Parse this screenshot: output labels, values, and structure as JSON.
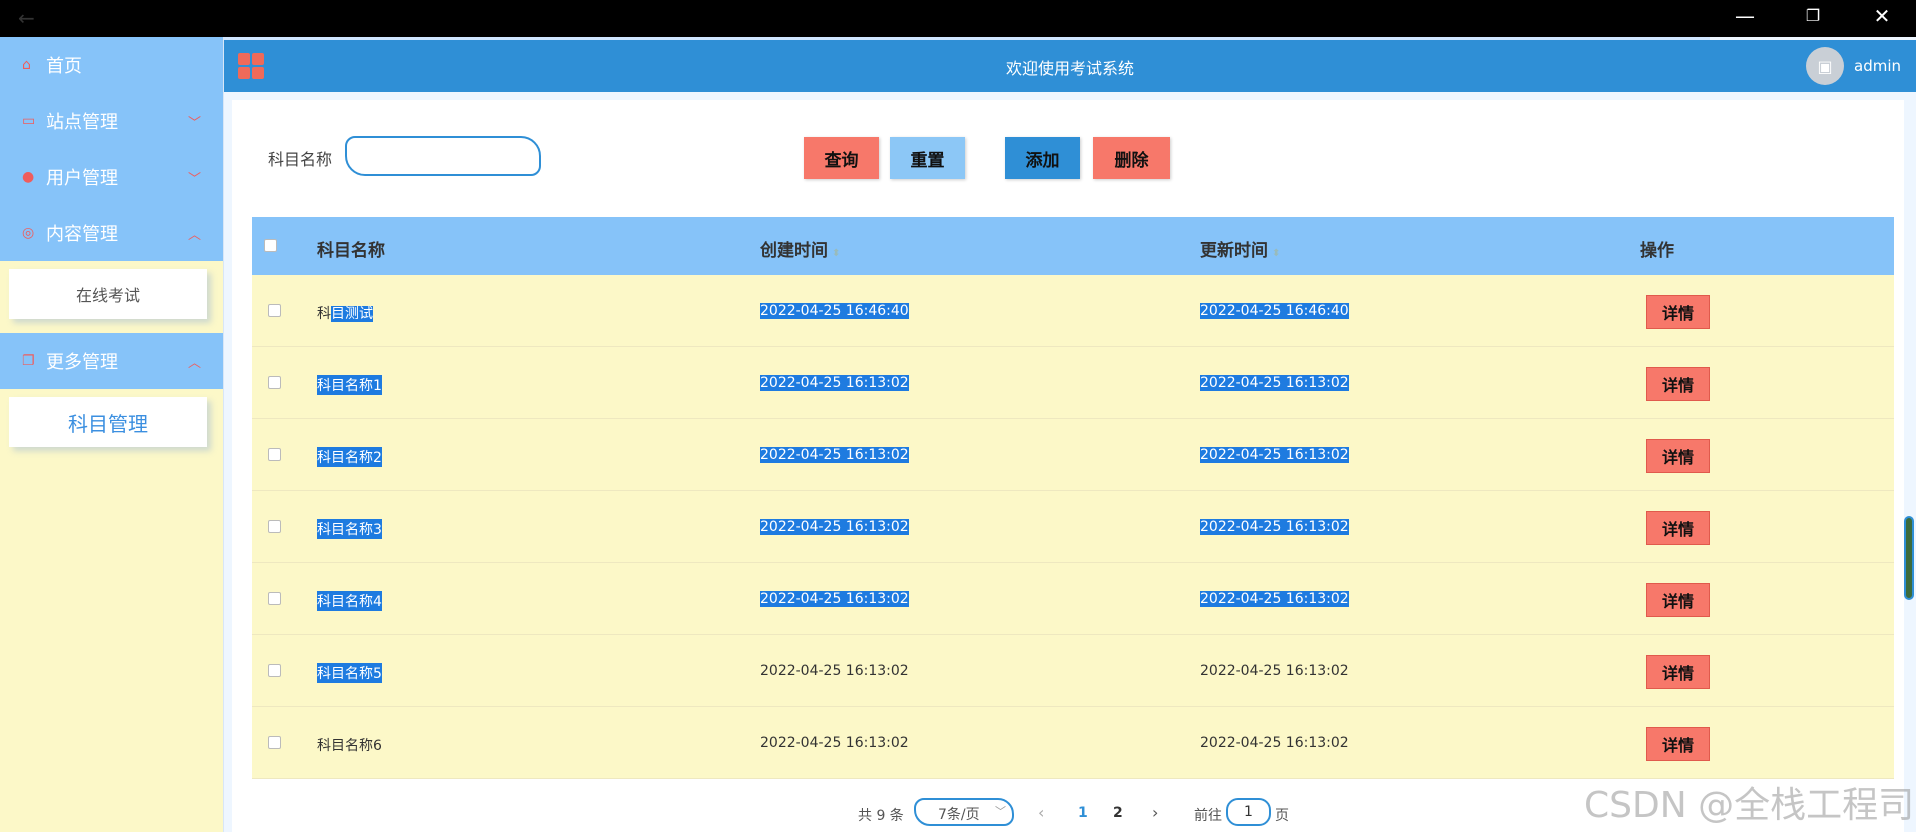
{
  "header": {
    "title": "欢迎使用考试系统",
    "username": "admin"
  },
  "sidebar": {
    "home": "首页",
    "site": "站点管理",
    "users": "用户管理",
    "content": "内容管理",
    "content_sub": "在线考试",
    "more": "更多管理",
    "more_sub": "科目管理"
  },
  "search": {
    "label": "科目名称",
    "value": "",
    "buttons": {
      "query": "查询",
      "reset": "重置",
      "add": "添加",
      "delete": "删除"
    }
  },
  "table": {
    "headers": {
      "name": "科目名称",
      "created": "创建时间",
      "updated": "更新时间",
      "actions": "操作"
    },
    "detail_label": "详情",
    "rows": [
      {
        "name_a": "科",
        "name_b": "目测试",
        "created": "2022-04-25 16:46:40",
        "updated": "2022-04-25 16:46:40"
      },
      {
        "name": "科目名称1",
        "created": "2022-04-25 16:13:02",
        "updated": "2022-04-25 16:13:02"
      },
      {
        "name": "科目名称2",
        "created": "2022-04-25 16:13:02",
        "updated": "2022-04-25 16:13:02"
      },
      {
        "name": "科目名称3",
        "created": "2022-04-25 16:13:02",
        "updated": "2022-04-25 16:13:02"
      },
      {
        "name": "科目名称4",
        "created": "2022-04-25 16:13:02",
        "updated": "2022-04-25 16:13:02"
      },
      {
        "name": "科目名称5",
        "created": "2022-04-25 16:13:02",
        "updated": "2022-04-25 16:13:02"
      },
      {
        "name": "科目名称6",
        "created": "2022-04-25 16:13:02",
        "updated": "2022-04-25 16:13:02"
      }
    ]
  },
  "pagination": {
    "total": "共 9 条",
    "page_size": "7条/页",
    "pages": [
      "1",
      "2"
    ],
    "goto_prefix": "前往",
    "goto_value": "1",
    "goto_suffix": "页"
  },
  "watermark": "CSDN @全栈工程司",
  "colors": {
    "primary": "#2f8fd6",
    "sidebar_bg": "#fcf8c8",
    "menu_bg": "#86c3f9",
    "danger": "#f7786a",
    "selection": "#1e7be0"
  }
}
